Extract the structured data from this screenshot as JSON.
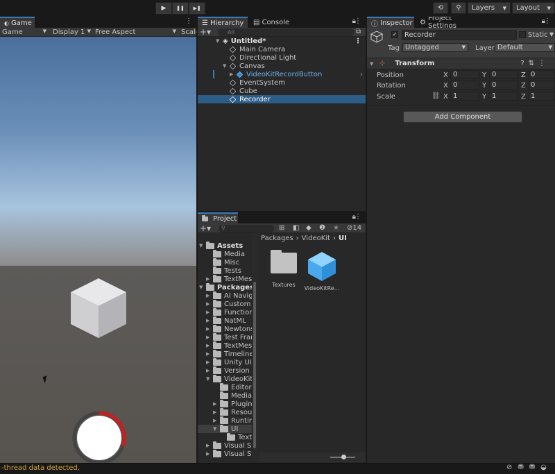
{
  "toolbar": {
    "play": "▶",
    "pause": "❚❚",
    "step": "▶❚",
    "history": "⟲",
    "search": "⚲",
    "layers": "Layers",
    "layout": "Layout"
  },
  "game": {
    "tab": "Game",
    "mode": "Game",
    "display": "Display 1",
    "aspect": "Free Aspect",
    "scale": "Scale"
  },
  "hierarchy": {
    "tab": "Hierarchy",
    "console_tab": "Console",
    "search_placeholder": "All",
    "scene": "Untitled*",
    "items": [
      "Main Camera",
      "Directional Light",
      "Canvas",
      "VideoKitRecordButton",
      "EventSystem",
      "Cube",
      "Recorder"
    ]
  },
  "project": {
    "tab": "Project",
    "count": "14",
    "breadcrumb": [
      "Packages",
      "VideoKit",
      "UI"
    ],
    "tree_assets": "Assets",
    "assets": [
      "Media",
      "Misc",
      "Tests",
      "TextMesh"
    ],
    "tree_packages": "Packages",
    "packages": [
      "AI Naviga",
      "Custom N",
      "Function",
      "NatML",
      "Newtonso",
      "Test Fram",
      "TextMesh",
      "Timeline",
      "Unity UI",
      "Version C",
      "VideoKit"
    ],
    "videokit_children": [
      "Editor",
      "Media",
      "Plugins",
      "Resour",
      "Runtim",
      "UI"
    ],
    "ui_children": [
      "Text"
    ],
    "after": [
      "Visual Sc",
      "Visual Stu"
    ],
    "grid": [
      {
        "name": "Textures",
        "icon": "folder-icon"
      },
      {
        "name": "VideoKitRe...",
        "icon": "prefab-icon"
      }
    ]
  },
  "inspector": {
    "tab": "Inspector",
    "settings_tab": "Project Settings",
    "object_name": "Recorder",
    "static": "Static",
    "tag_label": "Tag",
    "tag": "Untagged",
    "layer_label": "Layer",
    "layer": "Default",
    "component": "Transform",
    "rows": [
      {
        "label": "Position",
        "x": "0",
        "y": "0",
        "z": "0"
      },
      {
        "label": "Rotation",
        "x": "0",
        "y": "0",
        "z": "0"
      },
      {
        "label": "Scale",
        "x": "1",
        "y": "1",
        "z": "1"
      }
    ],
    "add_component": "Add Component"
  },
  "status": {
    "message": "-thread data detected."
  }
}
